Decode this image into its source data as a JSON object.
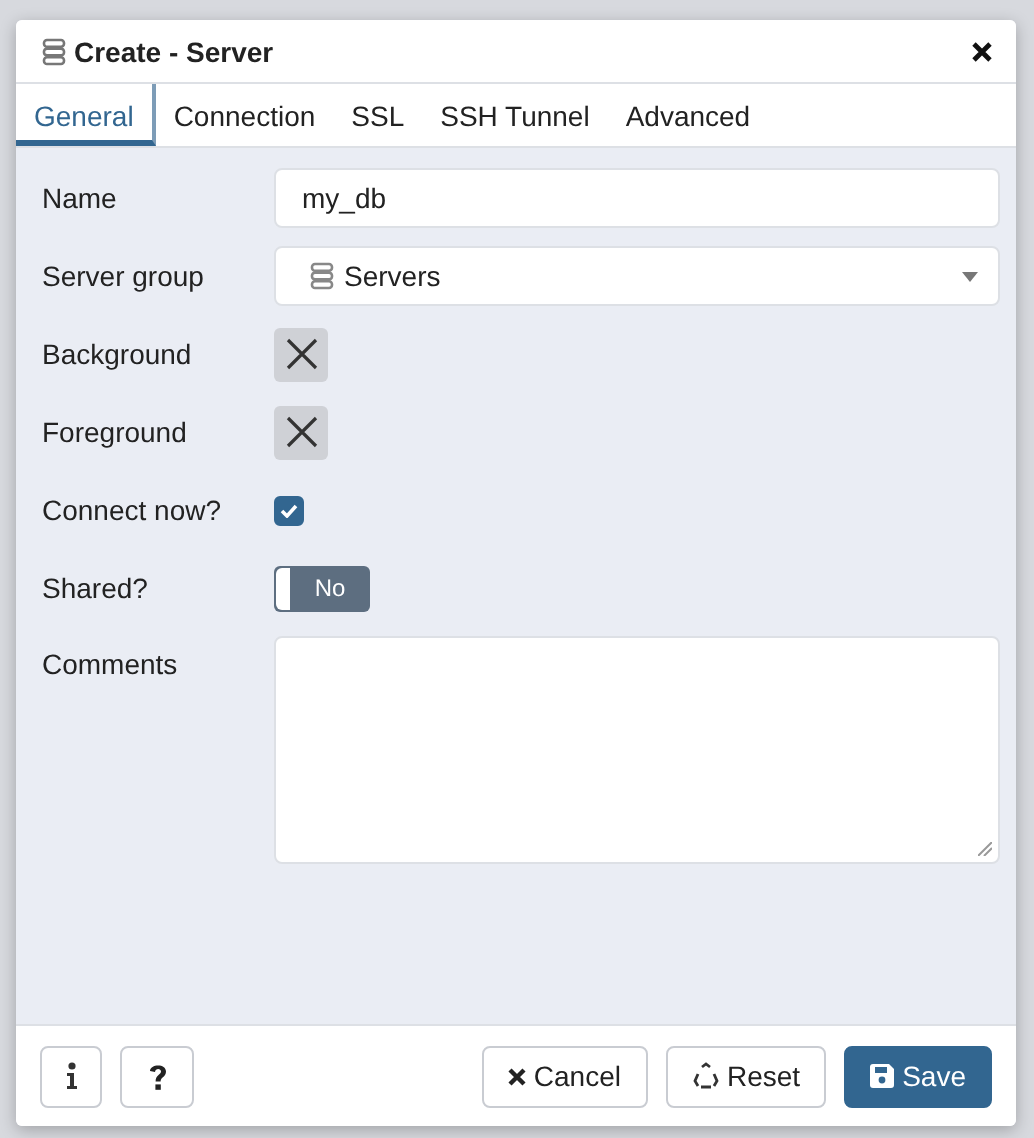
{
  "window": {
    "title": "Create - Server"
  },
  "tabs": [
    {
      "label": "General",
      "selected": true
    },
    {
      "label": "Connection",
      "selected": false
    },
    {
      "label": "SSL",
      "selected": false
    },
    {
      "label": "SSH Tunnel",
      "selected": false
    },
    {
      "label": "Advanced",
      "selected": false
    }
  ],
  "fields": [
    {
      "kind": "text",
      "label": "Name",
      "value": "my_db"
    },
    {
      "kind": "select",
      "label": "Server group",
      "value": "Servers"
    },
    {
      "kind": "color",
      "label": "Background"
    },
    {
      "kind": "color",
      "label": "Foreground"
    },
    {
      "kind": "checkbox",
      "label": "Connect now?",
      "checked": true
    },
    {
      "kind": "switch",
      "label": "Shared?",
      "on": false,
      "off_label": "No"
    },
    {
      "kind": "textarea",
      "label": "Comments"
    }
  ],
  "footer": {
    "left_buttons": [
      {
        "kind": "info"
      },
      {
        "kind": "help"
      }
    ],
    "buttons": [
      {
        "kind": "cancel",
        "label": "Cancel"
      },
      {
        "kind": "reset",
        "label": "Reset"
      },
      {
        "kind": "save",
        "label": "Save"
      }
    ]
  }
}
